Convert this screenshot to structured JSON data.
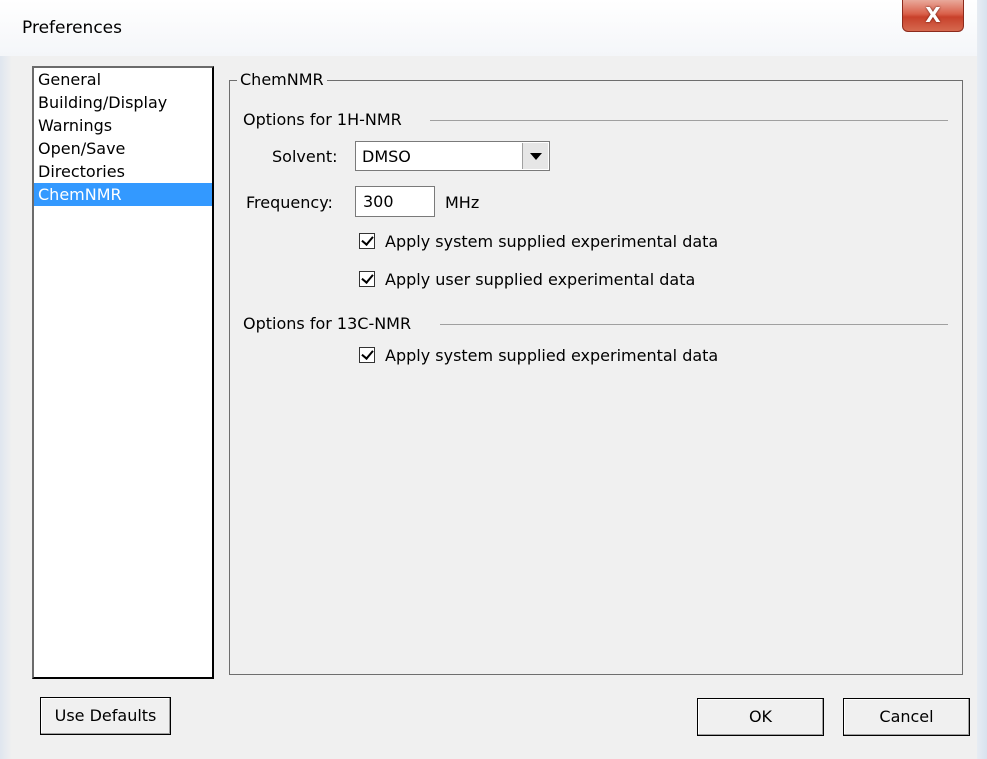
{
  "window": {
    "title": "Preferences",
    "close_label": "X"
  },
  "categories": {
    "items": [
      "General",
      "Building/Display",
      "Warnings",
      "Open/Save",
      "Directories",
      "ChemNMR"
    ],
    "selected": "ChemNMR"
  },
  "panel": {
    "group_title": "ChemNMR",
    "h1_section": {
      "title": "Options for 1H-NMR",
      "solvent_label": "Solvent:",
      "solvent_value": "DMSO",
      "frequency_label": "Frequency:",
      "frequency_value": "300",
      "frequency_unit": "MHz",
      "check_system": {
        "label": "Apply system supplied experimental data",
        "checked": true
      },
      "check_user": {
        "label": "Apply user supplied experimental data",
        "checked": true
      }
    },
    "c13_section": {
      "title": "Options for 13C-NMR",
      "check_system": {
        "label": "Apply system supplied experimental data",
        "checked": true
      }
    }
  },
  "buttons": {
    "use_defaults": "Use Defaults",
    "ok": "OK",
    "cancel": "Cancel"
  }
}
